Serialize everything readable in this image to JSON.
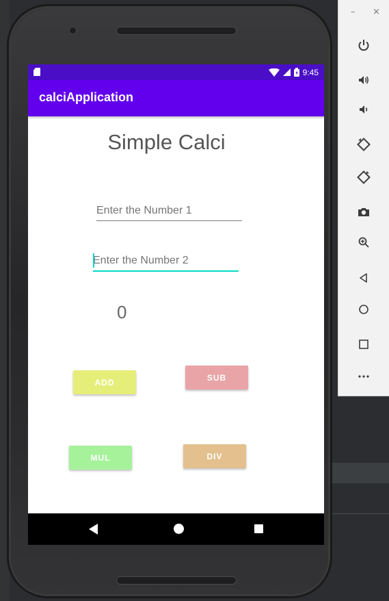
{
  "status_bar": {
    "time": "9:45"
  },
  "app_bar": {
    "title": "calciApplication"
  },
  "main": {
    "heading": "Simple Calci",
    "number1_placeholder": "Enter the Number 1",
    "number2_placeholder": "Enter the Number 2",
    "result": "0",
    "buttons": [
      {
        "label": "ADD",
        "color": "#e6ee7a"
      },
      {
        "label": "SUB",
        "color": "#e9a4a7"
      },
      {
        "label": "MUL",
        "color": "#a6f29b"
      },
      {
        "label": "DIV",
        "color": "#e3c08d"
      }
    ]
  },
  "nav_bar": {
    "icons": [
      "back-icon",
      "home-icon",
      "recents-icon"
    ]
  },
  "emulator_toolbar": {
    "window_controls": [
      "–",
      "×"
    ],
    "icons": [
      "power-icon",
      "volume-up-icon",
      "volume-down-icon",
      "rotate-left-icon",
      "rotate-right-icon",
      "camera-icon",
      "zoom-icon",
      "back-icon",
      "home-icon",
      "overview-icon",
      "more-icon"
    ]
  },
  "colors": {
    "status_bar": "#4a0ec7",
    "app_bar": "#6200ee",
    "accent": "#03dac5"
  }
}
